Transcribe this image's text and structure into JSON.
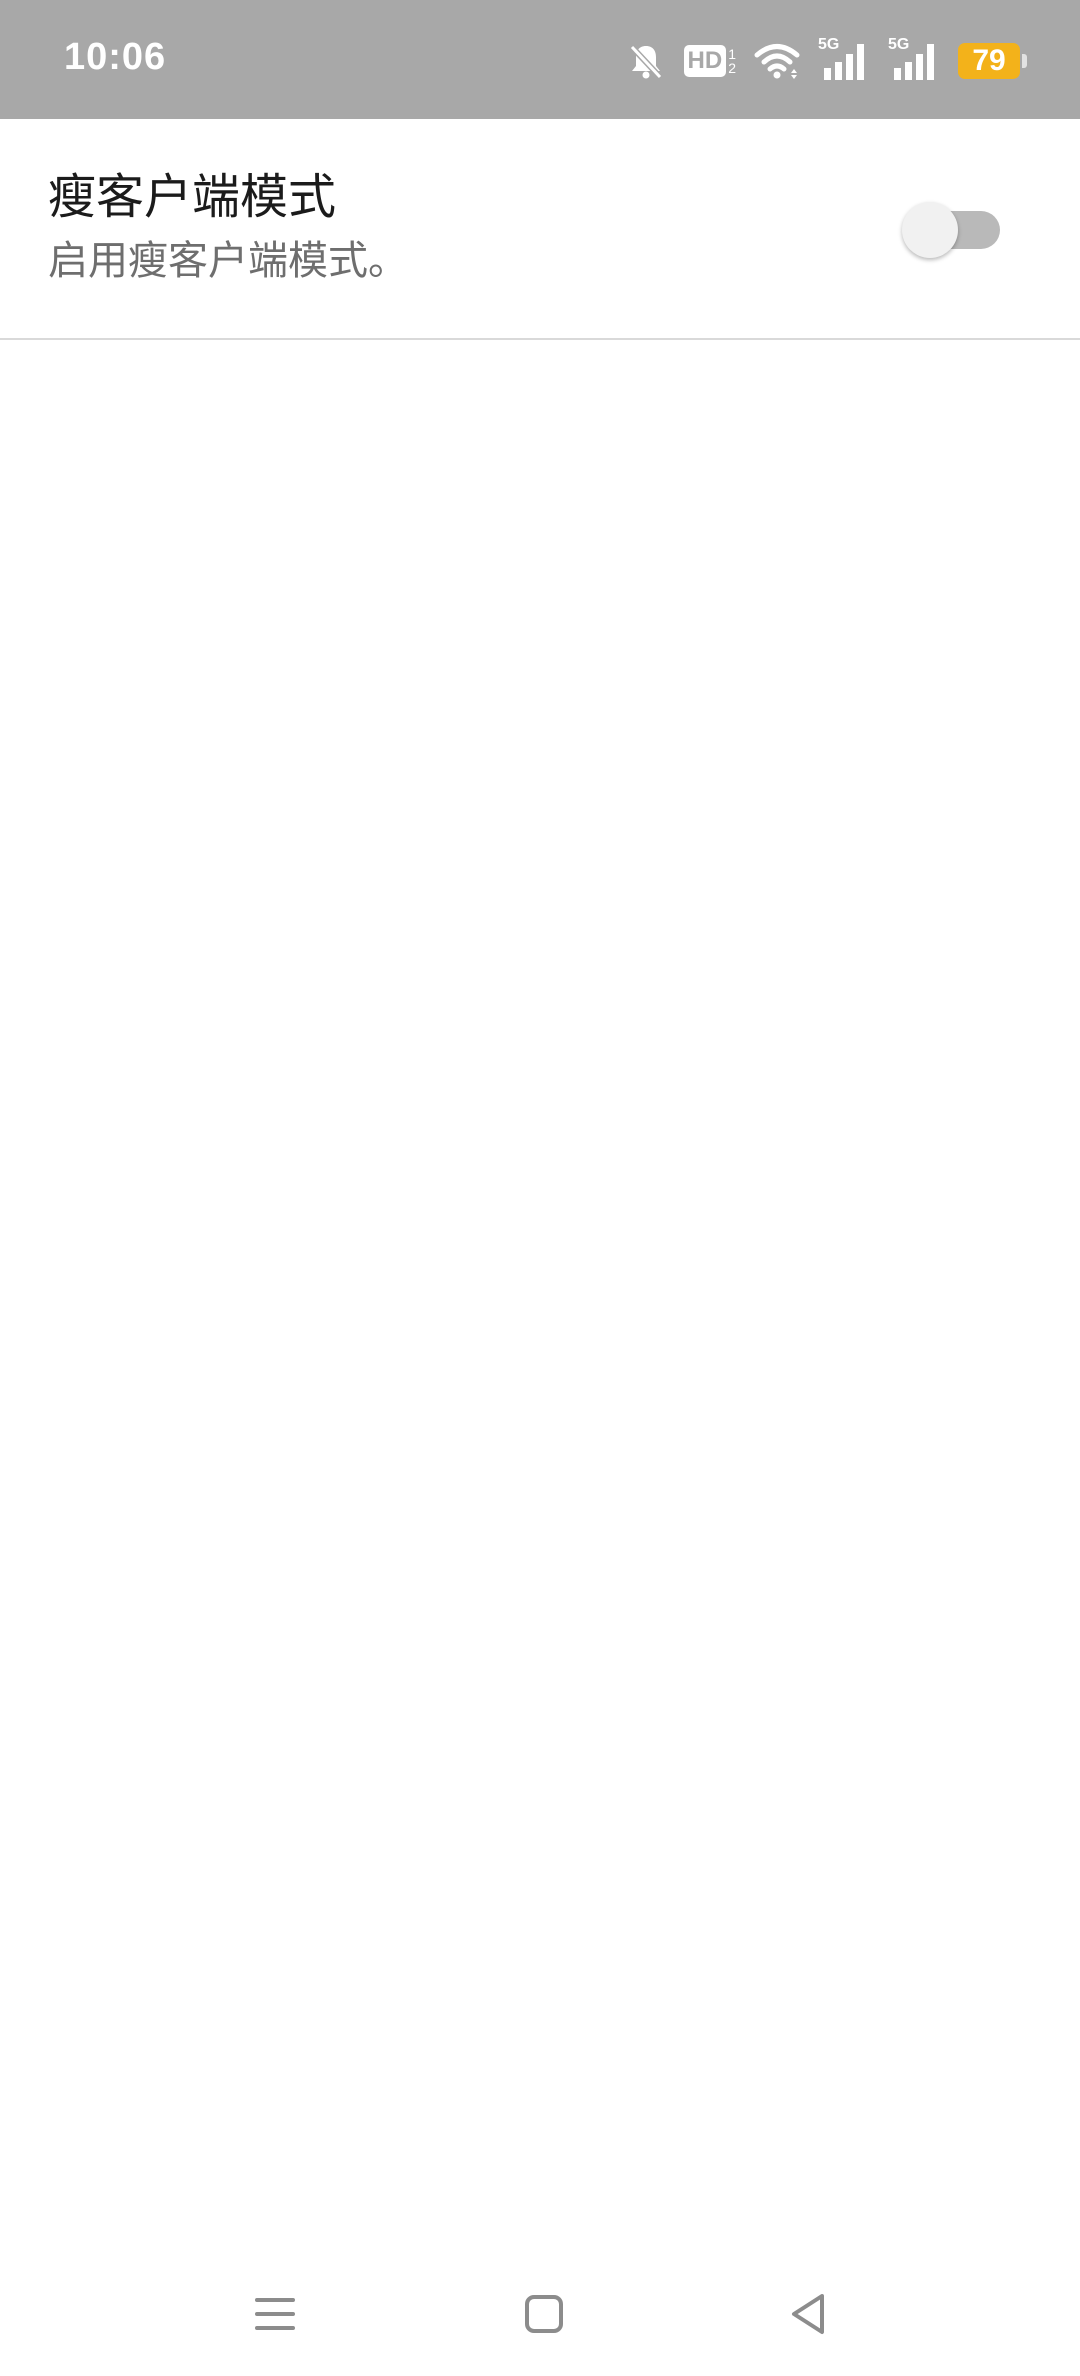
{
  "status_bar": {
    "time": "10:06",
    "battery_level": "79",
    "icons": [
      "bell-muted-icon",
      "hd-voice-icon",
      "wifi-icon",
      "signal-5g-sim1-icon",
      "signal-5g-sim2-icon",
      "battery-icon"
    ],
    "background_color": "#a8a8a8",
    "battery_color": "#f3b21a",
    "hd_label": "HD",
    "sim1_label": "1",
    "sim2_label": "2",
    "net_label": "5G"
  },
  "setting": {
    "title": "瘦客户端模式",
    "summary": "启用瘦客户端模式。",
    "switch_on": false
  },
  "nav_bar": {
    "buttons": [
      "menu-icon",
      "home-icon",
      "back-icon"
    ]
  }
}
